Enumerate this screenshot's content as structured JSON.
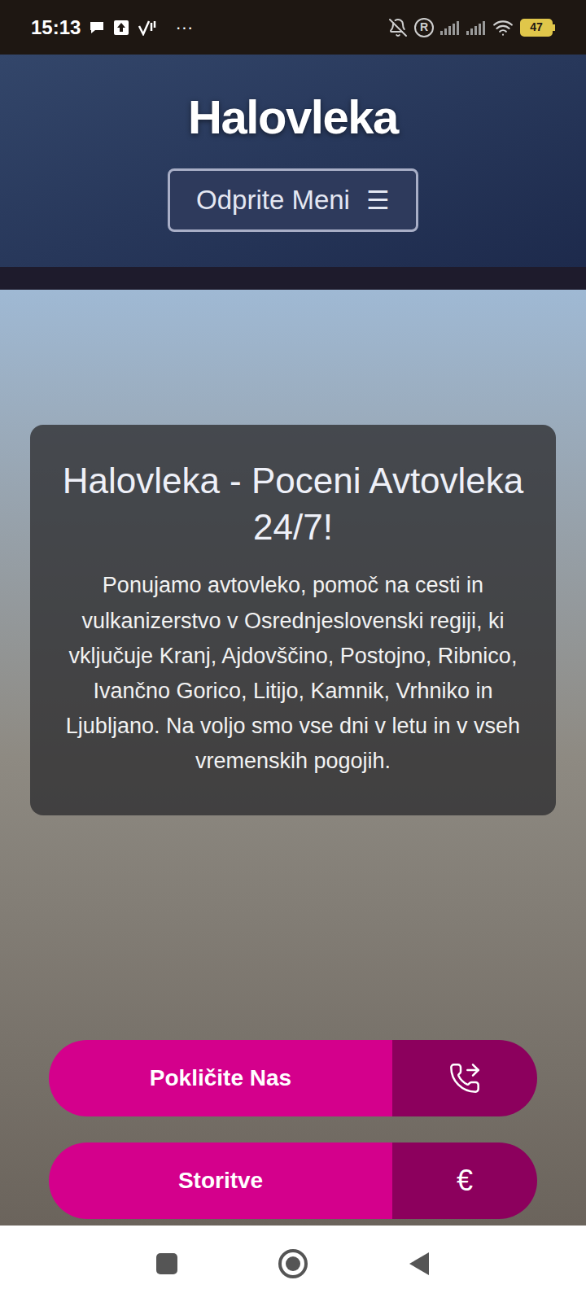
{
  "status_bar": {
    "time": "15:13",
    "more": "···",
    "roaming": "R",
    "battery": "47"
  },
  "header": {
    "logo": "Halovleka",
    "menu_button": {
      "label": "Odprite Meni",
      "icon": "☰"
    }
  },
  "hero": {
    "title": "Halovleka - Poceni Avtovleka 24/7!",
    "text": "Ponujamo avtovleko, pomoč na cesti in vulkanizerstvo v Osrednjeslovenski regiji, ki vključuje Kranj, Ajdovščino, Postojno, Ribnico, Ivančno Gorico, Litijo, Kamnik, Vrhniko in Ljubljano. Na voljo smo vse dni v letu in v vseh vremenskih pogojih."
  },
  "buttons": [
    {
      "label": "Pokličite Nas",
      "kind": "phone",
      "symbol": ""
    },
    {
      "label": "Storitve",
      "kind": "symbol",
      "symbol": "€"
    }
  ]
}
